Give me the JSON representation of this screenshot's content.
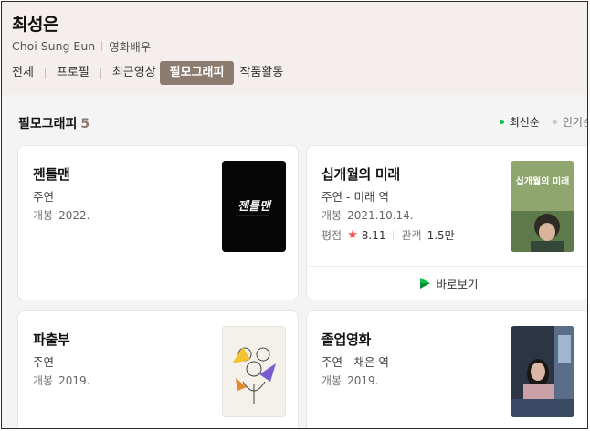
{
  "person": {
    "name": "최성은",
    "english_name": "Choi Sung Eun",
    "job": "영화배우"
  },
  "tabs": [
    {
      "label": "전체",
      "active": false
    },
    {
      "label": "프로필",
      "active": false
    },
    {
      "label": "최근영상",
      "active": false
    },
    {
      "label": "필모그래피",
      "active": true
    },
    {
      "label": "작품활동",
      "active": false
    }
  ],
  "filmography": {
    "title": "필모그래피",
    "count": "5",
    "sort": {
      "latest": "최신순",
      "popular": "인기순"
    },
    "open_label": "개봉",
    "rating_label": "평점",
    "audience_label": "관객",
    "watch_label": "바로보기",
    "items": [
      {
        "title": "젠틀맨",
        "role": "주연",
        "open": "2022.",
        "poster_text": "젠틀맨"
      },
      {
        "title": "십개월의 미래",
        "role": "주연 - 미래 역",
        "open": "2021.10.14.",
        "rating": "8.11",
        "audience": "1.5만",
        "poster_text": "십개월의 미래"
      },
      {
        "title": "파출부",
        "role": "주연",
        "open": "2019."
      },
      {
        "title": "졸업영화",
        "role": "주연 - 채은 역",
        "open": "2019."
      }
    ]
  },
  "colors": {
    "accent": "#8c7b6f",
    "active_dot": "#10c050",
    "star": "#ff4d4d"
  }
}
